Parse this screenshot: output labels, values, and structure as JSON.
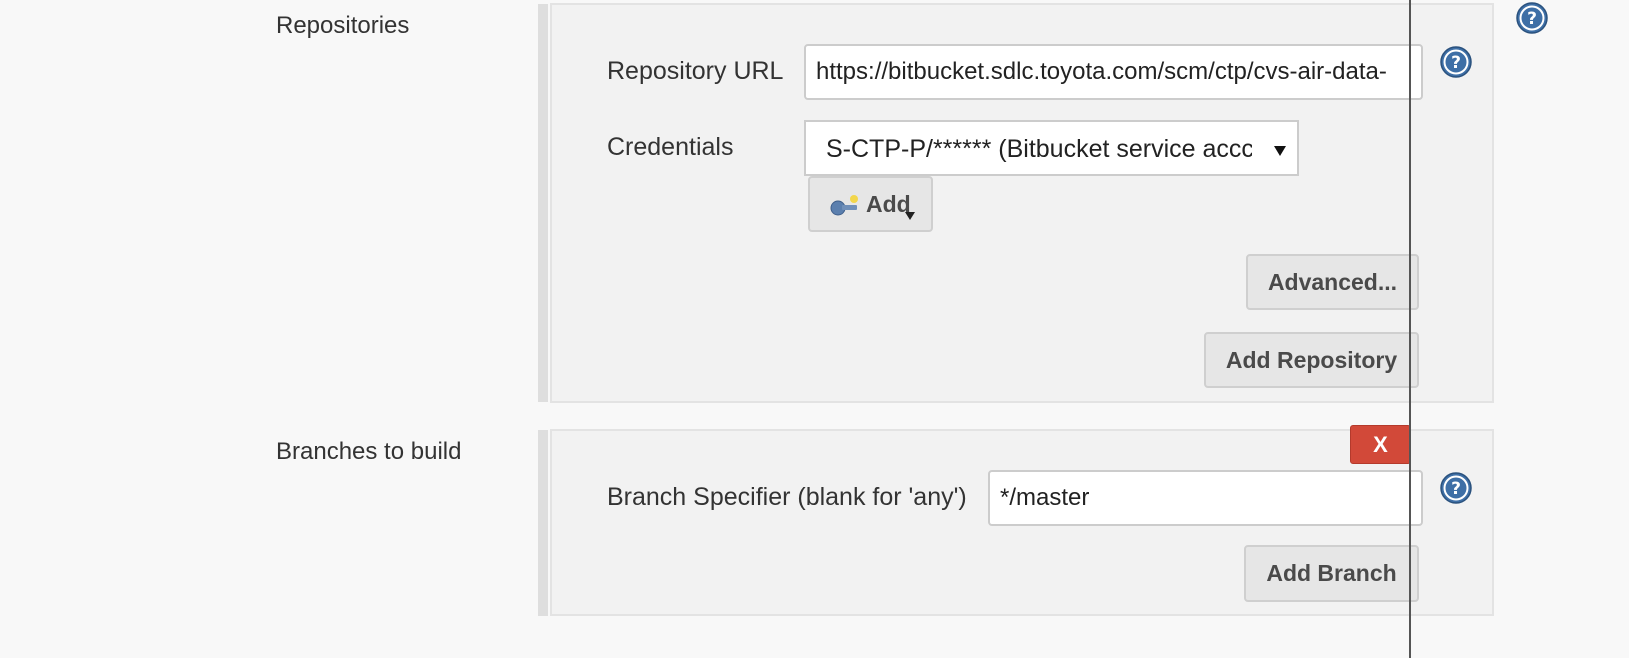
{
  "repositories": {
    "section_label": "Repositories",
    "repository_url_label": "Repository URL",
    "repository_url_value": "https://bitbucket.sdlc.toyota.com/scm/ctp/cvs-air-data-",
    "credentials_label": "Credentials",
    "credentials_selected": "S-CTP-P/****** (Bitbucket service accc",
    "add_credentials_button": "Add",
    "advanced_button": "Advanced...",
    "add_repository_button": "Add Repository"
  },
  "branches": {
    "section_label": "Branches to build",
    "delete_button": "X",
    "branch_specifier_label": "Branch Specifier (blank for 'any')",
    "branch_specifier_value": "*/master",
    "add_branch_button": "Add Branch"
  },
  "icons": {
    "help": "help-question-icon",
    "key": "key-icon",
    "dropdown": "dropdown-arrow-icon"
  },
  "colors": {
    "help_blue": "#3e6fa6",
    "delete_red": "#d24939"
  }
}
